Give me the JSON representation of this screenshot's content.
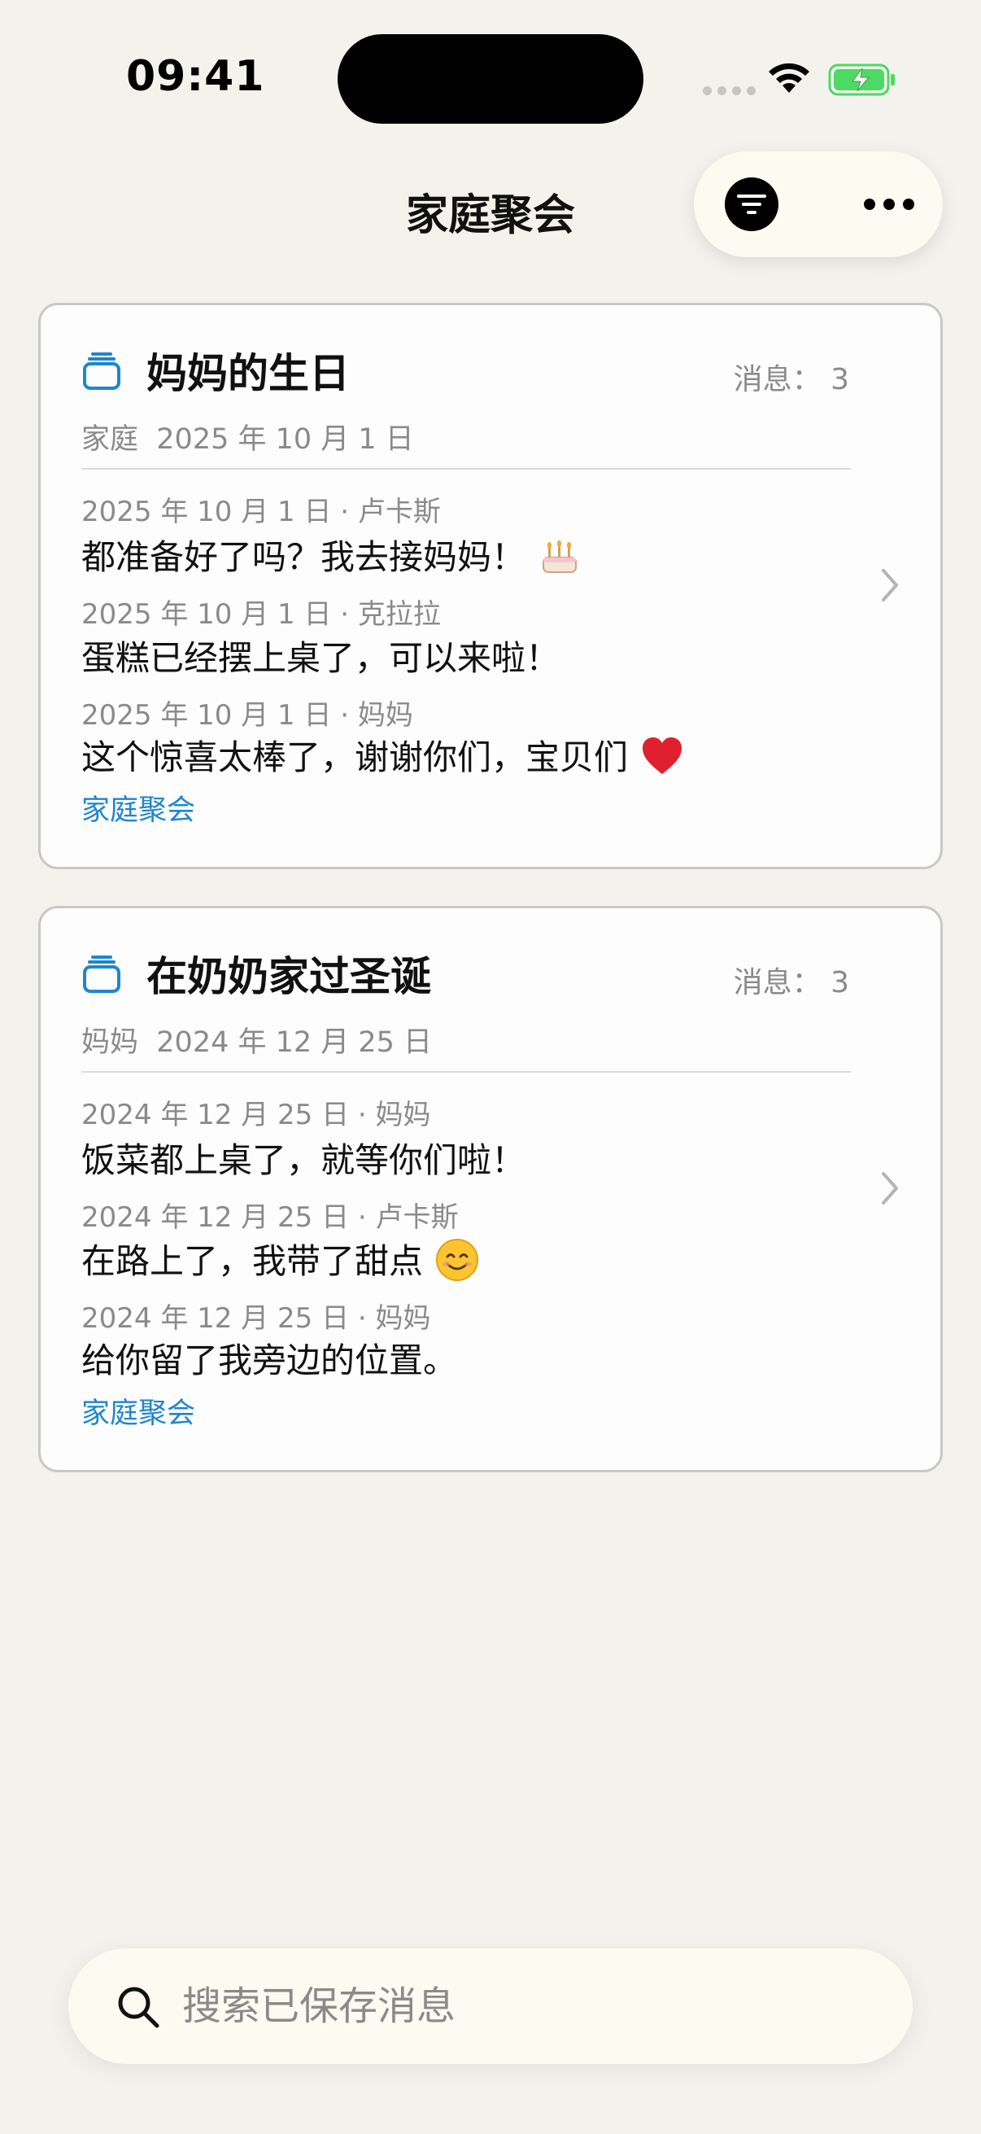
{
  "status_bar": {
    "time": "09:41"
  },
  "nav": {
    "title": "家庭聚会"
  },
  "cards": [
    {
      "title": "妈妈的生日",
      "count_label": "消息：",
      "count": "3",
      "subtitle_group": "家庭",
      "subtitle_date": "2025 年 10 月 1 日",
      "messages": [
        {
          "meta": "2025 年 10 月 1 日 · 卢卡斯",
          "text": "都准备好了吗？我去接妈妈！",
          "emoji": "birthday-cake"
        },
        {
          "meta": "2025 年 10 月 1 日 · 克拉拉",
          "text": "蛋糕已经摆上桌了，可以来啦！",
          "emoji": ""
        },
        {
          "meta": "2025 年 10 月 1 日 · 妈妈",
          "text": "这个惊喜太棒了，谢谢你们，宝贝们",
          "emoji": "red-heart"
        }
      ],
      "tag": "家庭聚会"
    },
    {
      "title": "在奶奶家过圣诞",
      "count_label": "消息：",
      "count": "3",
      "subtitle_group": "妈妈",
      "subtitle_date": "2024 年 12 月 25 日",
      "messages": [
        {
          "meta": "2024 年 12 月 25 日 · 妈妈",
          "text": "饭菜都上桌了，就等你们啦！",
          "emoji": ""
        },
        {
          "meta": "2024 年 12 月 25 日 · 卢卡斯",
          "text": "在路上了，我带了甜点",
          "emoji": "smiling-face"
        },
        {
          "meta": "2024 年 12 月 25 日 · 妈妈",
          "text": "给你留了我旁边的位置。",
          "emoji": ""
        }
      ],
      "tag": "家庭聚会"
    }
  ],
  "search": {
    "placeholder": "搜索已保存消息",
    "value": ""
  },
  "colors": {
    "accent": "#1f86cc",
    "background": "#f4f2ec",
    "card_border": "#c8c8c6"
  }
}
